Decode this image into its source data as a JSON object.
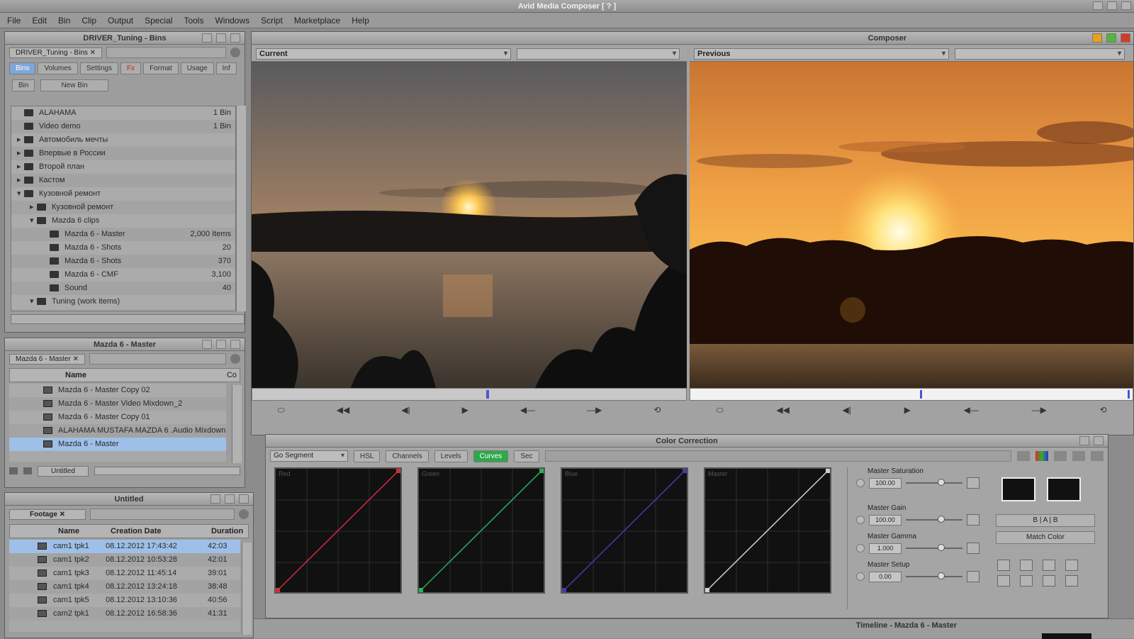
{
  "app": {
    "title": "Avid Media Composer",
    "title_suffix": "[ ? ]"
  },
  "menu": [
    "File",
    "Edit",
    "Bin",
    "Clip",
    "Output",
    "Special",
    "Tools",
    "Windows",
    "Script",
    "Marketplace",
    "Help"
  ],
  "bin1": {
    "title": "DRIVER_Tuning - Bins",
    "tab_name": "DRIVER_Tuning - Bins",
    "tabs": [
      "Bins",
      "Volumes",
      "Settings",
      "Fx",
      "Format",
      "Usage",
      "Inf"
    ],
    "buttons": [
      "Bin",
      "New Bin"
    ],
    "items": [
      {
        "label": "ALAHAMA",
        "value": "1 Bin",
        "level": 0,
        "tri": ""
      },
      {
        "label": "Video demo",
        "value": "1 Bin",
        "level": 0,
        "tri": ""
      },
      {
        "label": "Автомобиль мечты",
        "value": "",
        "level": 0,
        "tri": "▸"
      },
      {
        "label": "Впервые в России",
        "value": "",
        "level": 0,
        "tri": "▸"
      },
      {
        "label": "Второй план",
        "value": "",
        "level": 0,
        "tri": "▸"
      },
      {
        "label": "Кастом",
        "value": "",
        "level": 0,
        "tri": "▸"
      },
      {
        "label": "Кузовной ремонт",
        "value": "",
        "level": 0,
        "tri": "▾"
      },
      {
        "label": "Кузовной ремонт",
        "value": "",
        "level": 1,
        "tri": "▸"
      },
      {
        "label": "Mazda 6 clips",
        "value": "",
        "level": 1,
        "tri": "▾"
      },
      {
        "label": "Mazda 6 - Master",
        "value": "2,000 Items",
        "level": 2,
        "tri": ""
      },
      {
        "label": "Mazda 6 - Shots",
        "value": "20",
        "level": 2,
        "tri": ""
      },
      {
        "label": "Mazda 6 - Shots",
        "value": "370",
        "level": 2,
        "tri": ""
      },
      {
        "label": "Mazda 6 - CMF",
        "value": "3,100",
        "level": 2,
        "tri": ""
      },
      {
        "label": "Sound",
        "value": "40",
        "level": 2,
        "tri": ""
      },
      {
        "label": "Tuning (work items)",
        "value": "",
        "level": 1,
        "tri": "▾"
      }
    ]
  },
  "bin2": {
    "title": "Mazda 6 - Master",
    "tab_name": "Mazda 6 - Master",
    "column_name": "Name",
    "column_extra": "Co",
    "items": [
      "Mazda 6 - Master Copy 02",
      "Mazda 6 - Master Video Mixdown_2",
      "Mazda 6 - Master Copy 01",
      "ALAHAMA MUSTAFA MAZDA 6 .Audio Mixdown",
      "Mazda 6 - Master"
    ],
    "footer_label": "Untitled"
  },
  "bin3": {
    "title": "Untitled",
    "tab_name": "Footage",
    "columns": [
      "Name",
      "Creation Date",
      "Duration"
    ],
    "rows": [
      [
        "cam1 tpk1",
        "08.12.2012 17:43:42",
        "42:03"
      ],
      [
        "cam1 tpk2",
        "08.12.2012 10:53:28",
        "42:01"
      ],
      [
        "cam1 tpk3",
        "08.12.2012 11:45:14",
        "39:01"
      ],
      [
        "cam1 tpk4",
        "08.12.2012 13:24:18",
        "38:48"
      ],
      [
        "cam1 tpk5",
        "08.12.2012 13:10:36",
        "40:56"
      ],
      [
        "cam2 tpk1",
        "08.12.2012 16:58:36",
        "41:31"
      ]
    ]
  },
  "composer": {
    "title": "Composer",
    "source_label": "Current",
    "record_label": "Previous",
    "source_controls": [
      "⬭",
      "◀◀",
      "◀|",
      "▶",
      "◀—",
      "—▶",
      "⟲"
    ],
    "record_controls": [
      "⬭",
      "◀◀",
      "◀|",
      "▶",
      "◀—",
      "—▶",
      "⟲"
    ]
  },
  "color_correction": {
    "title": "Color Correction",
    "mode": "Go Segment",
    "tabs": [
      "HSL",
      "Channels",
      "Levels",
      "Curves",
      "Sec"
    ],
    "active_tab": "Curves",
    "curves": [
      {
        "name": "Red",
        "color": "#d02f3b"
      },
      {
        "name": "Green",
        "color": "#22b55a"
      },
      {
        "name": "Blue",
        "color": "#4a3aa8"
      },
      {
        "name": "Master",
        "color": "#cfcfcf"
      }
    ],
    "sliders": [
      {
        "label": "Master Saturation",
        "value": "100.00",
        "level": 0.62
      },
      {
        "label": "Master Gain",
        "value": "100.00",
        "level": 0.62
      },
      {
        "label": "Master Gamma",
        "value": "1.000",
        "level": 0.62
      },
      {
        "label": "Master Setup",
        "value": "0.00",
        "level": 0.62
      }
    ],
    "side_button_1": "B | A | B",
    "side_button_2": "Match Color"
  },
  "timeline": {
    "title": "Timeline - Mazda 6 - Master"
  }
}
